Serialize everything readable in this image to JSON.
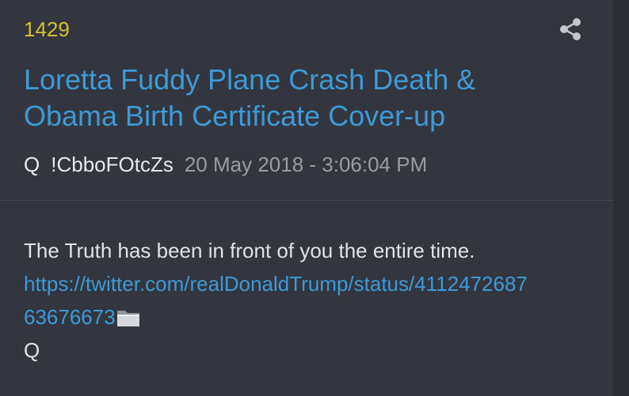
{
  "post": {
    "number": "1429",
    "title_line1": "Loretta Fuddy Plane Crash Death &",
    "title_line2": "Obama Birth Certificate Cover-up",
    "author": "Q",
    "tripcode": "!CbboFOtcZs",
    "date": "20 May 2018 - 3:06:04 PM",
    "body_line1": "The Truth has been in front of you the entire time.",
    "link_line1": "https://twitter.com/realDonaldTrump/status/4112472687",
    "link_line2": "63676673",
    "signature": "Q"
  },
  "icons": {
    "share": "share-icon",
    "folder": "folder-icon"
  },
  "colors": {
    "background": "#33363f",
    "post_number": "#d4c22a",
    "link": "#3d9ad6",
    "text": "#e2e2e5",
    "muted": "#9a9ca3"
  }
}
